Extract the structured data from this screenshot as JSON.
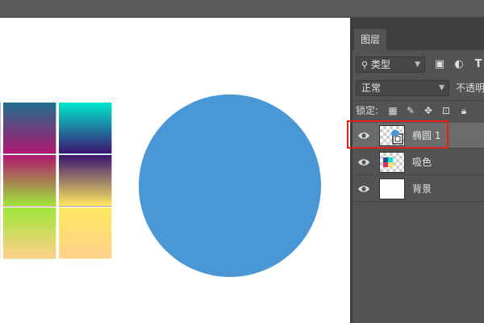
{
  "colors": {
    "circle": "#4a97d6",
    "highlight": "#e0201a",
    "panel_bg": "#535353"
  },
  "swatches": [
    [
      "#1a4f8a",
      "#1f6f8f",
      "#00e8d0"
    ],
    [
      "#e02a7a",
      "#b0166e",
      "#3a1470"
    ],
    [
      "#e8d0b0",
      "#9ee63a",
      "#ffe860"
    ]
  ],
  "layers_panel": {
    "tab_label": "图层",
    "kind_select": {
      "label": "类型",
      "icon": "search-icon"
    },
    "filter_icons": [
      "image-filter-icon",
      "adjustment-filter-icon",
      "text-filter-icon"
    ],
    "blend_mode": "正常",
    "opacity_label": "不透明",
    "lock_label": "锁定:",
    "lock_icons": [
      "lock-transparent-icon",
      "lock-brush-icon",
      "lock-move-icon",
      "lock-artboard-icon",
      "lock-all-icon"
    ],
    "layers": [
      {
        "name": "椭圆 1",
        "visible": true,
        "selected": true,
        "thumb": "shape"
      },
      {
        "name": "吸色",
        "visible": true,
        "selected": false,
        "thumb": "image"
      },
      {
        "name": "背景",
        "visible": true,
        "selected": false,
        "thumb": "white"
      }
    ]
  }
}
